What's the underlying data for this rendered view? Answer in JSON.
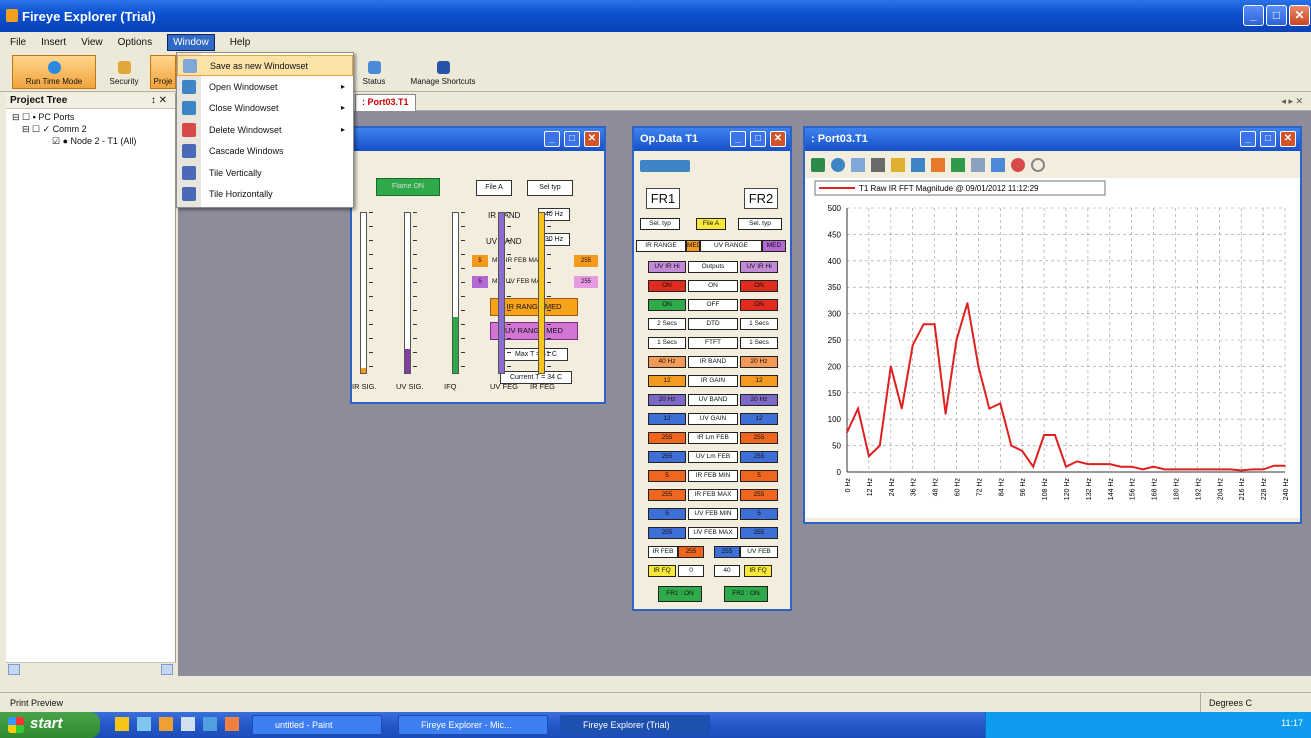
{
  "app": {
    "title": "Fireye Explorer (Trial)"
  },
  "menubar": [
    "File",
    "Insert",
    "View",
    "Options",
    "Window",
    "Help"
  ],
  "toolbar": {
    "run_time_mode": "Run Time Mode",
    "security": "Security",
    "project": "Proje",
    "status": "Status",
    "manage_shortcuts": "Manage Shortcuts"
  },
  "window_menu": [
    {
      "label": "Save as new Windowset",
      "arrow": ""
    },
    {
      "label": "Open Windowset",
      "arrow": "▸"
    },
    {
      "label": "Close Windowset",
      "arrow": "▸"
    },
    {
      "label": "Delete Windowset",
      "arrow": "▸"
    },
    {
      "label": "Cascade Windows",
      "arrow": ""
    },
    {
      "label": "Tile Vertically",
      "arrow": ""
    },
    {
      "label": "Tile Horizontally",
      "arrow": ""
    }
  ],
  "project_tree": {
    "title": "Project Tree",
    "pin": "↕ ✕",
    "items": [
      "PC Ports",
      "Comm 2",
      "Node 2 - T1 (All)"
    ]
  },
  "tabstrip": {
    "active_tab": ": Port03.T1",
    "nav": "◂ ▸ ✕"
  },
  "signals_window": {
    "header_btn": "Flame ON",
    "file_btn": "File A",
    "sel_btn": "Sel typ",
    "ir_band_label": "IR BAND",
    "ir_band_val": "40 Hz",
    "uv_band_label": "UV BAND",
    "uv_band_val": "30 Hz",
    "min_ir": "MIN IR FEB MAX",
    "min_ir_lo": "5",
    "min_ir_hi": "255",
    "min_uv": "MIN UV FEB MAX",
    "min_uv_lo": "5",
    "min_uv_hi": "255",
    "ir_range": "IR RANGE MED",
    "uv_range": "UV RANGE MED",
    "max_t": "Max T = 41 C",
    "current_t": "Current T = 34 C",
    "gauge_labels": [
      "IR SIG.",
      "UV SIG.",
      "IFQ",
      "UV FEG",
      "IR FEG"
    ],
    "gauge_levels": [
      0.03,
      0.15,
      0.35,
      1.0,
      1.0
    ],
    "gauge_colors": [
      "#f39a1f",
      "#8040a8",
      "#2eaa4a",
      "#8a6bd0",
      "#f7c518"
    ]
  },
  "opdata_window": {
    "title": "Op.Data T1",
    "fr1": "FR1",
    "fr2": "FR2",
    "header_row": [
      "Sel. typ",
      "File A",
      "Sel. typ"
    ],
    "range_row": [
      "IR RANGE",
      "MED",
      "UV RANGE",
      "MED"
    ],
    "rows": [
      {
        "l": "UV IR Hi",
        "m": "Outputs",
        "r": "UV IR Hi",
        "lc": "#c28bd8",
        "rc": "#c28bd8"
      },
      {
        "l": "ON",
        "m": "ON",
        "r": "ON",
        "lc": "#e12b1f",
        "rc": "#e12b1f"
      },
      {
        "l": "ON",
        "m": "OFF",
        "r": "ON",
        "lc": "#2eaa4a",
        "rc": "#e12b1f"
      },
      {
        "l": "2 Secs",
        "m": "DTD",
        "r": "1 Secs",
        "lc": "#fff",
        "rc": "#fff"
      },
      {
        "l": "1 Secs",
        "m": "FTFT",
        "r": "1 Secs",
        "lc": "#fff",
        "rc": "#fff"
      },
      {
        "l": "40 Hz",
        "m": "IR BAND",
        "r": "20 Hz",
        "lc": "#f39a58",
        "rc": "#f39a58"
      },
      {
        "l": "12",
        "m": "IR GAIN",
        "r": "12",
        "lc": "#f39a1f",
        "rc": "#f39a1f"
      },
      {
        "l": "20 Hz",
        "m": "UV BAND",
        "r": "20 Hz",
        "lc": "#7d6ac8",
        "rc": "#7d6ac8"
      },
      {
        "l": "12",
        "m": "UV GAIN",
        "r": "12",
        "lc": "#3d6fd6",
        "rc": "#3d6fd6"
      },
      {
        "l": "255",
        "m": "IR Lm FEB",
        "r": "255",
        "lc": "#f0661f",
        "rc": "#f0661f"
      },
      {
        "l": "255",
        "m": "UV Lm FEB",
        "r": "255",
        "lc": "#3d6fd6",
        "rc": "#3d6fd6"
      },
      {
        "l": "5",
        "m": "IR FEB MIN",
        "r": "5",
        "lc": "#f0661f",
        "rc": "#f0661f"
      },
      {
        "l": "255",
        "m": "IR FEB MAX",
        "r": "255",
        "lc": "#f0661f",
        "rc": "#f0661f"
      },
      {
        "l": "5",
        "m": "UV FEB MIN",
        "r": "5",
        "lc": "#3d6fd6",
        "rc": "#3d6fd6"
      },
      {
        "l": "255",
        "m": "UV FEB MAX",
        "r": "255",
        "lc": "#3d6fd6",
        "rc": "#3d6fd6"
      }
    ],
    "feb_row": [
      "IR FEB",
      "255",
      "255",
      "UV FEB"
    ],
    "fq_row": [
      "IR FQ",
      "0",
      "40",
      "IR FQ"
    ],
    "status": [
      "FR1 : ON",
      "FR2 : ON"
    ]
  },
  "chart_data": {
    "type": "line",
    "window_title": ": Port03.T1",
    "title": "",
    "legend": "T1 Raw IR FFT Magnitude @ 09/01/2012 11:12:29",
    "x_ticks": [
      "0 Hz",
      "12 Hz",
      "24 Hz",
      "36 Hz",
      "48 Hz",
      "60 Hz",
      "72 Hz",
      "84 Hz",
      "96 Hz",
      "108 Hz",
      "120 Hz",
      "132 Hz",
      "144 Hz",
      "156 Hz",
      "168 Hz",
      "180 Hz",
      "192 Hz",
      "204 Hz",
      "216 Hz",
      "228 Hz",
      "240 Hz"
    ],
    "ylim": [
      0,
      500
    ],
    "y_ticks": [
      0,
      50,
      100,
      150,
      200,
      250,
      300,
      350,
      400,
      450,
      500
    ],
    "grid": true,
    "series": [
      {
        "name": "T1 Raw IR FFT Magnitude @ 09/01/2012 11:12:29",
        "color": "#e02020",
        "x": [
          0,
          6,
          12,
          18,
          24,
          30,
          36,
          42,
          48,
          54,
          60,
          66,
          72,
          78,
          84,
          90,
          96,
          102,
          108,
          114,
          120,
          126,
          132,
          138,
          144,
          150,
          156,
          162,
          168,
          174,
          180,
          186,
          192,
          198,
          204,
          210,
          216,
          222,
          228,
          234,
          240
        ],
        "y": [
          75,
          120,
          30,
          50,
          200,
          120,
          240,
          280,
          280,
          110,
          250,
          320,
          200,
          120,
          130,
          50,
          40,
          10,
          70,
          70,
          10,
          20,
          15,
          15,
          15,
          10,
          10,
          5,
          10,
          5,
          5,
          5,
          5,
          5,
          5,
          5,
          3,
          5,
          5,
          12,
          12
        ]
      }
    ]
  },
  "statusbar": {
    "left": "Print Preview",
    "right": "Degrees C"
  },
  "taskbar": {
    "start": "start",
    "tasks": [
      "untitled - Paint",
      "Fireye Explorer - Mic...",
      "Fireye Explorer (Trial)"
    ],
    "clock": "11:17"
  }
}
